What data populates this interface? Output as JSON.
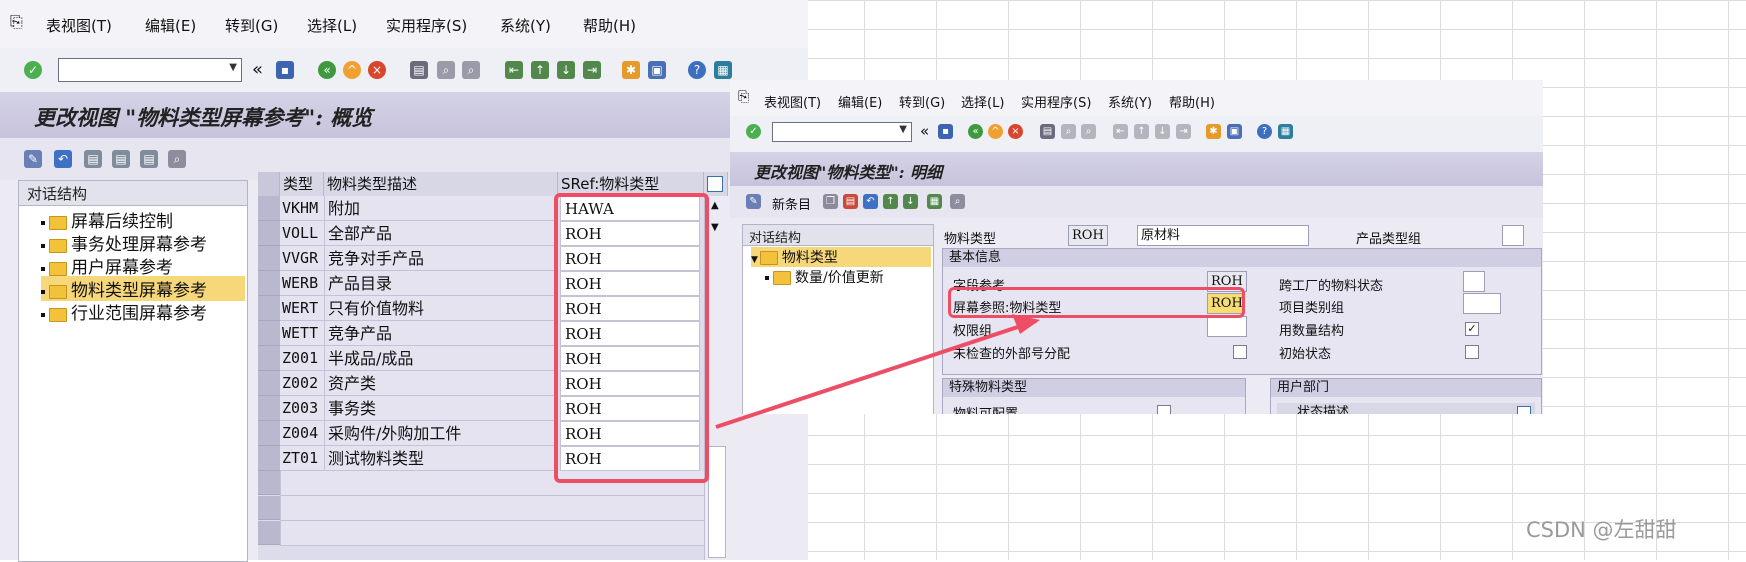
{
  "left": {
    "menu": [
      "表视图(T)",
      "编辑(E)",
      "转到(G)",
      "选择(L)",
      "实用程序(S)",
      "系统(Y)",
      "帮助(H)"
    ],
    "title": "更改视图 \"物料类型屏幕参考\": 概览",
    "dialog_structure": {
      "header": "对话结构",
      "items": [
        "屏幕后续控制",
        "事务处理屏幕参考",
        "用户屏幕参考",
        "物料类型屏幕参考",
        "行业范围屏幕参考"
      ],
      "selected_index": 3
    },
    "table": {
      "headers": [
        "类型",
        "物料类型描述",
        "SRef:物料类型"
      ],
      "rows": [
        {
          "code": "VKHM",
          "desc": "附加",
          "sref": "HAWA"
        },
        {
          "code": "VOLL",
          "desc": "全部产品",
          "sref": "ROH"
        },
        {
          "code": "VVGR",
          "desc": "竞争对手产品",
          "sref": "ROH"
        },
        {
          "code": "WERB",
          "desc": "产品目录",
          "sref": "ROH"
        },
        {
          "code": "WERT",
          "desc": "只有价值物料",
          "sref": "ROH"
        },
        {
          "code": "WETT",
          "desc": "竞争产品",
          "sref": "ROH"
        },
        {
          "code": "Z001",
          "desc": "半成品/成品",
          "sref": "ROH"
        },
        {
          "code": "Z002",
          "desc": "资产类",
          "sref": "ROH"
        },
        {
          "code": "Z003",
          "desc": "事务类",
          "sref": "ROH"
        },
        {
          "code": "Z004",
          "desc": "采购件/外购加工件",
          "sref": "ROH"
        },
        {
          "code": "ZT01",
          "desc": "测试物料类型",
          "sref": "ROH"
        }
      ]
    }
  },
  "right": {
    "menu": [
      "表视图(T)",
      "编辑(E)",
      "转到(G)",
      "选择(L)",
      "实用程序(S)",
      "系统(Y)",
      "帮助(H)"
    ],
    "title": "更改视图\"物料类型\": 明细",
    "new_entry": "新条目",
    "dialog_structure": {
      "header": "对话结构",
      "items": [
        "物料类型",
        "数量/价值更新"
      ]
    },
    "material_type_label": "物料类型",
    "material_type_code": "ROH",
    "material_type_desc": "原材料",
    "product_type_group_label": "产品类型组",
    "basic_info": {
      "header": "基本信息",
      "field_ref_label": "字段参考",
      "field_ref_value": "ROH",
      "screen_ref_label": "屏幕参照:物料类型",
      "screen_ref_value": "ROH",
      "auth_group_label": "权限组",
      "unchecked_ext_label": "未检查的外部号分配",
      "cross_plant_label": "跨工厂的物料状态",
      "item_cat_group_label": "项目类别组",
      "qty_structure_label": "用数量结构",
      "qty_structure_checked": true,
      "initial_status_label": "初始状态"
    },
    "special_types": {
      "header": "特殊物料类型",
      "configurable_label": "物料可配置"
    },
    "user_dept": {
      "header": "用户部门",
      "status_desc": "状态描述"
    }
  },
  "watermark": "CSDN @左甜甜",
  "colors": {
    "highlight": "#ee4d66",
    "folder": "#f3c23b",
    "title_bg": "#c6c3dc"
  }
}
